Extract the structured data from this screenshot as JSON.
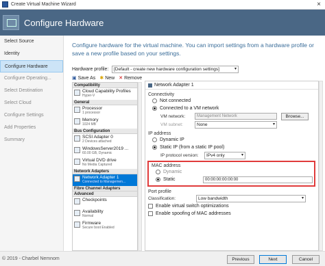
{
  "window": {
    "title": "Create Virtual Machine Wizard",
    "close_glyph": "×"
  },
  "header": {
    "title": "Configure Hardware"
  },
  "nav": {
    "items": [
      {
        "label": "Select Source",
        "state": "normal"
      },
      {
        "label": "Identity",
        "state": "normal"
      },
      {
        "label": "Configure Hardware",
        "state": "selected"
      },
      {
        "label": "Configure Operating...",
        "state": "disabled"
      },
      {
        "label": "Select Destination",
        "state": "disabled"
      },
      {
        "label": "Select Cloud",
        "state": "disabled"
      },
      {
        "label": "Configure Settings",
        "state": "disabled"
      },
      {
        "label": "Add Properties",
        "state": "disabled"
      },
      {
        "label": "Summary",
        "state": "disabled"
      }
    ]
  },
  "main": {
    "description": "Configure hardware for the virtual machine. You can import settings from a hardware profile or save a new profile based on your settings.",
    "hardware_profile_label": "Hardware profile:",
    "hardware_profile_value": "[Default - create new hardware configuration settings]",
    "toolbar": {
      "save_as": "Save As",
      "new": "New",
      "remove": "Remove"
    }
  },
  "tree": {
    "sections": [
      {
        "title": "Compatibility",
        "items": [
          {
            "title": "Cloud Capability Profiles",
            "sub": "Hyper-V"
          }
        ]
      },
      {
        "title": "General",
        "items": [
          {
            "title": "Processor",
            "sub": "1 processor"
          },
          {
            "title": "Memory",
            "sub": "1024 MB"
          }
        ]
      },
      {
        "title": "Bus Configuration",
        "items": [
          {
            "title": "SCSI Adapter 0",
            "sub": "2 Devices attached"
          },
          {
            "title": "WindowsServer2019 ...",
            "sub": "60.00 GB, Dynamic"
          },
          {
            "title": "Virtual DVD drive",
            "sub": "No Media Captured"
          }
        ]
      },
      {
        "title": "Network Adapters",
        "items": [
          {
            "title": "Network Adapter 1",
            "sub": "Connected to Managemen...",
            "selected": true
          }
        ]
      },
      {
        "title": "Fibre Channel Adapters",
        "items": []
      },
      {
        "title": "Advanced",
        "items": [
          {
            "title": "Checkpoints",
            "sub": ""
          },
          {
            "title": "Availability",
            "sub": "Normal"
          },
          {
            "title": "Firmware",
            "sub": "Secure boot Enabled"
          }
        ]
      }
    ]
  },
  "detail": {
    "title": "Network Adapter 1",
    "connectivity_label": "Connectivity",
    "not_connected": "Not connected",
    "connected_vm_network": "Connected to a VM network",
    "vm_network_label": "VM network:",
    "vm_network_value": "Management Network",
    "browse_label": "Browse...",
    "vm_subnet_label": "VM subnet:",
    "vm_subnet_value": "None",
    "ip_address_label": "IP address",
    "dynamic_ip": "Dynamic IP",
    "static_ip": "Static IP (from a static IP pool)",
    "ip_protocol_label": "IP protocol version:",
    "ip_protocol_value": "IPv4 only",
    "mac_address_label": "MAC address",
    "mac_dynamic": "Dynamic",
    "mac_static": "Static",
    "mac_value": "00:00:00:00:00:00",
    "port_profile_label": "Port profile",
    "classification_label": "Classification:",
    "classification_value": "Low bandwidth",
    "enable_vswitch": "Enable virtual switch optimizations",
    "enable_mac_spoofing": "Enable spoofing of MAC addresses"
  },
  "footer": {
    "copyright": "© 2019 - Charbel Nemnom",
    "previous": "Previous",
    "next": "Next",
    "cancel": "Cancel"
  },
  "colors": {
    "header_bg": "#4a6785",
    "highlight": "#e03a3a",
    "selected_bg": "#0078d7"
  }
}
